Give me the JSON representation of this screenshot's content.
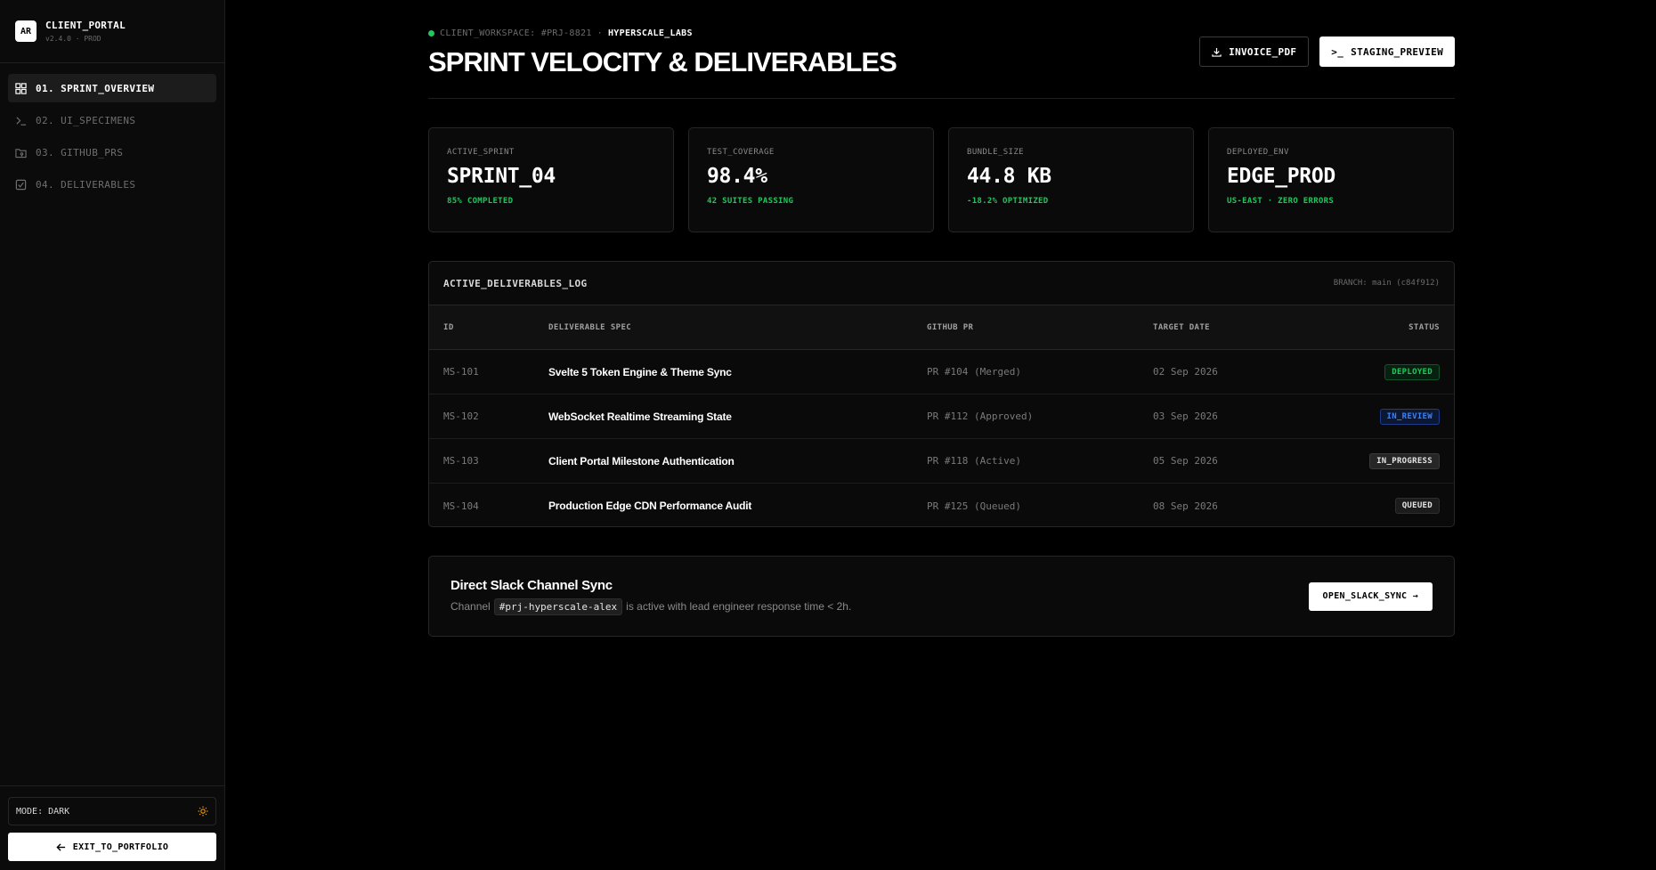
{
  "sidebar": {
    "logo": "AR",
    "app_name": "CLIENT_PORTAL",
    "version": "v2.4.0 · PROD",
    "items": [
      {
        "label": "01. SPRINT_OVERVIEW",
        "icon": "grid-icon",
        "active": true
      },
      {
        "label": "02. UI_SPECIMENS",
        "icon": "terminal-icon",
        "active": false
      },
      {
        "label": "03. GITHUB_PRS",
        "icon": "folder-git-icon",
        "active": false
      },
      {
        "label": "04. DELIVERABLES",
        "icon": "checkbox-icon",
        "active": false
      }
    ],
    "mode_label": "MODE: DARK",
    "exit_label": "EXIT_TO_PORTFOLIO"
  },
  "header": {
    "workspace": "CLIENT_WORKSPACE: #PRJ-8821",
    "separator": "·",
    "org": "HYPERSCALE_LABS",
    "title": "SPRINT VELOCITY & DELIVERABLES",
    "invoice_label": "INVOICE_PDF",
    "staging_label": "STAGING_PREVIEW",
    "staging_prefix": ">_"
  },
  "stats": [
    {
      "label": "ACTIVE_SPRINT",
      "value": "SPRINT_04",
      "sub": "85% COMPLETED"
    },
    {
      "label": "TEST_COVERAGE",
      "value": "98.4%",
      "sub": "42 SUITES PASSING"
    },
    {
      "label": "BUNDLE_SIZE",
      "value": "44.8 KB",
      "sub": "-18.2% OPTIMIZED"
    },
    {
      "label": "DEPLOYED_ENV",
      "value": "EDGE_PROD",
      "sub": "US-EAST · ZERO ERRORS"
    }
  ],
  "table": {
    "title": "ACTIVE_DELIVERABLES_LOG",
    "branch": "BRANCH: main (c84f912)",
    "columns": [
      "ID",
      "DELIVERABLE SPEC",
      "GITHUB PR",
      "TARGET DATE",
      "STATUS"
    ],
    "rows": [
      {
        "id": "MS-101",
        "spec": "Svelte 5 Token Engine & Theme Sync",
        "pr": "PR #104 (Merged)",
        "date": "02 Sep 2026",
        "status": "DEPLOYED"
      },
      {
        "id": "MS-102",
        "spec": "WebSocket Realtime Streaming State",
        "pr": "PR #112 (Approved)",
        "date": "03 Sep 2026",
        "status": "IN_REVIEW"
      },
      {
        "id": "MS-103",
        "spec": "Client Portal Milestone Authentication",
        "pr": "PR #118 (Active)",
        "date": "05 Sep 2026",
        "status": "IN_PROGRESS"
      },
      {
        "id": "MS-104",
        "spec": "Production Edge CDN Performance Audit",
        "pr": "PR #125 (Queued)",
        "date": "08 Sep 2026",
        "status": "QUEUED"
      }
    ]
  },
  "slack": {
    "title": "Direct Slack Channel Sync",
    "desc_prefix": "Channel",
    "channel": "#prj-hyperscale-alex",
    "desc_suffix": "is active with lead engineer response time < 2h.",
    "button": "OPEN_SLACK_SYNC →"
  },
  "colors": {
    "background": "#000000",
    "success": "#22c55e",
    "review": "#3b82f6",
    "accent_sun": "#f59e0b"
  }
}
